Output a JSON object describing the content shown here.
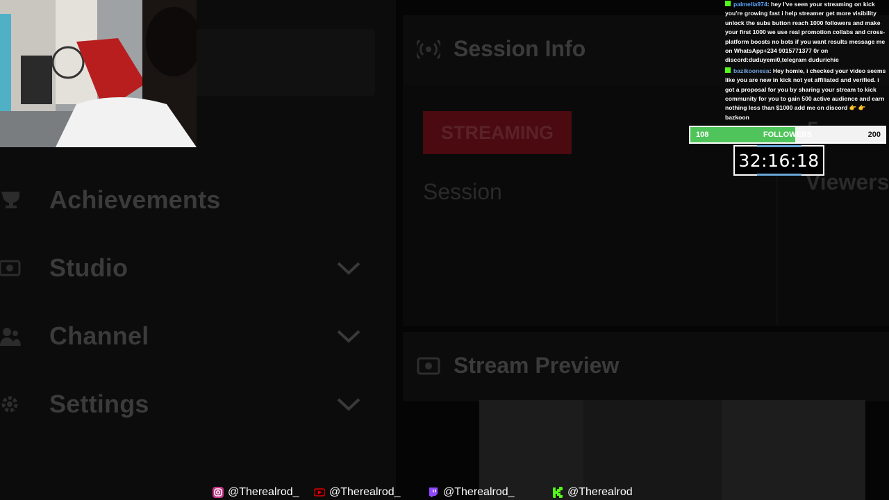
{
  "sidebar": {
    "items": [
      {
        "label": "Achievements",
        "icon": "trophy-icon",
        "has_chevron": false
      },
      {
        "label": "Studio",
        "icon": "camera-icon",
        "has_chevron": true
      },
      {
        "label": "Channel",
        "icon": "users-icon",
        "has_chevron": true
      },
      {
        "label": "Settings",
        "icon": "gear-icon",
        "has_chevron": true
      }
    ]
  },
  "session_info": {
    "title": "Session Info",
    "icon": "broadcast-icon",
    "status": "STREAMING",
    "session_label": "Session",
    "viewers_label": "Viewers",
    "viewers_count": "5"
  },
  "stream_preview": {
    "title": "Stream Preview",
    "icon": "camera-icon"
  },
  "chat": {
    "messages": [
      {
        "user": "palmella974",
        "text": ": hey I've seen your streaming on kick you're growing fast i help streamer get more visibility unlock the subs button reach 1000 followers and make your first 1000 we use real promotion collabs and cross-platform boosts no bots if you want results message me on WhatsApp+234 9015771377 0r on discord:duduyemi0,telegram dudurichie"
      },
      {
        "user": "bazikoonesa",
        "text": ": Hey homie, i checked your video seems like you are new in kick not yet affiliated and verified. i got a proposal for you by sharing your stream to kick community for you to gain 500 active audience and earn nothing less than $1000 add me on discord 👉 👉 bazkoon"
      }
    ]
  },
  "followers_goal": {
    "current": "108",
    "label": "FOLLOWERS",
    "target": "200",
    "progress": 0.54
  },
  "timer": {
    "value": "32:16:18"
  },
  "socials": [
    {
      "platform": "instagram-icon",
      "handle": "@Therealrod_",
      "color": "#c13584"
    },
    {
      "platform": "youtube-icon",
      "handle": "@Therealrod_",
      "color": "#ff0000"
    },
    {
      "platform": "twitch-icon",
      "handle": "@Therealrod_",
      "color": "#9146ff"
    },
    {
      "platform": "kick-icon",
      "handle": "@Therealrod",
      "color": "#53fc18"
    }
  ],
  "colors": {
    "streaming_badge": "#4a0a10",
    "followers_fill": "#4fc45a",
    "kick_green": "#53fc18"
  }
}
